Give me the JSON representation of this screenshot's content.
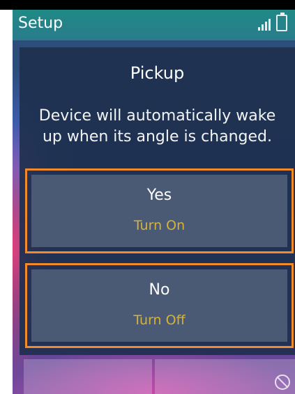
{
  "status_bar": {
    "title": "Setup",
    "signal_icon": "signal-icon",
    "battery_icon": "battery-icon"
  },
  "dialog": {
    "title": "Pickup",
    "message": "Device will automatically wake up when its angle is changed."
  },
  "options": [
    {
      "label": "Yes",
      "sublabel": "Turn On"
    },
    {
      "label": "No",
      "sublabel": "Turn Off"
    }
  ],
  "softkeys": {
    "right_icon": "no-entry-icon"
  },
  "colors": {
    "status_bar": "#1f8a86",
    "panel": "#1e304e",
    "option_bg": "#4a5a74",
    "highlight_border": "#f08a2a",
    "sublabel": "#d6b23a"
  }
}
